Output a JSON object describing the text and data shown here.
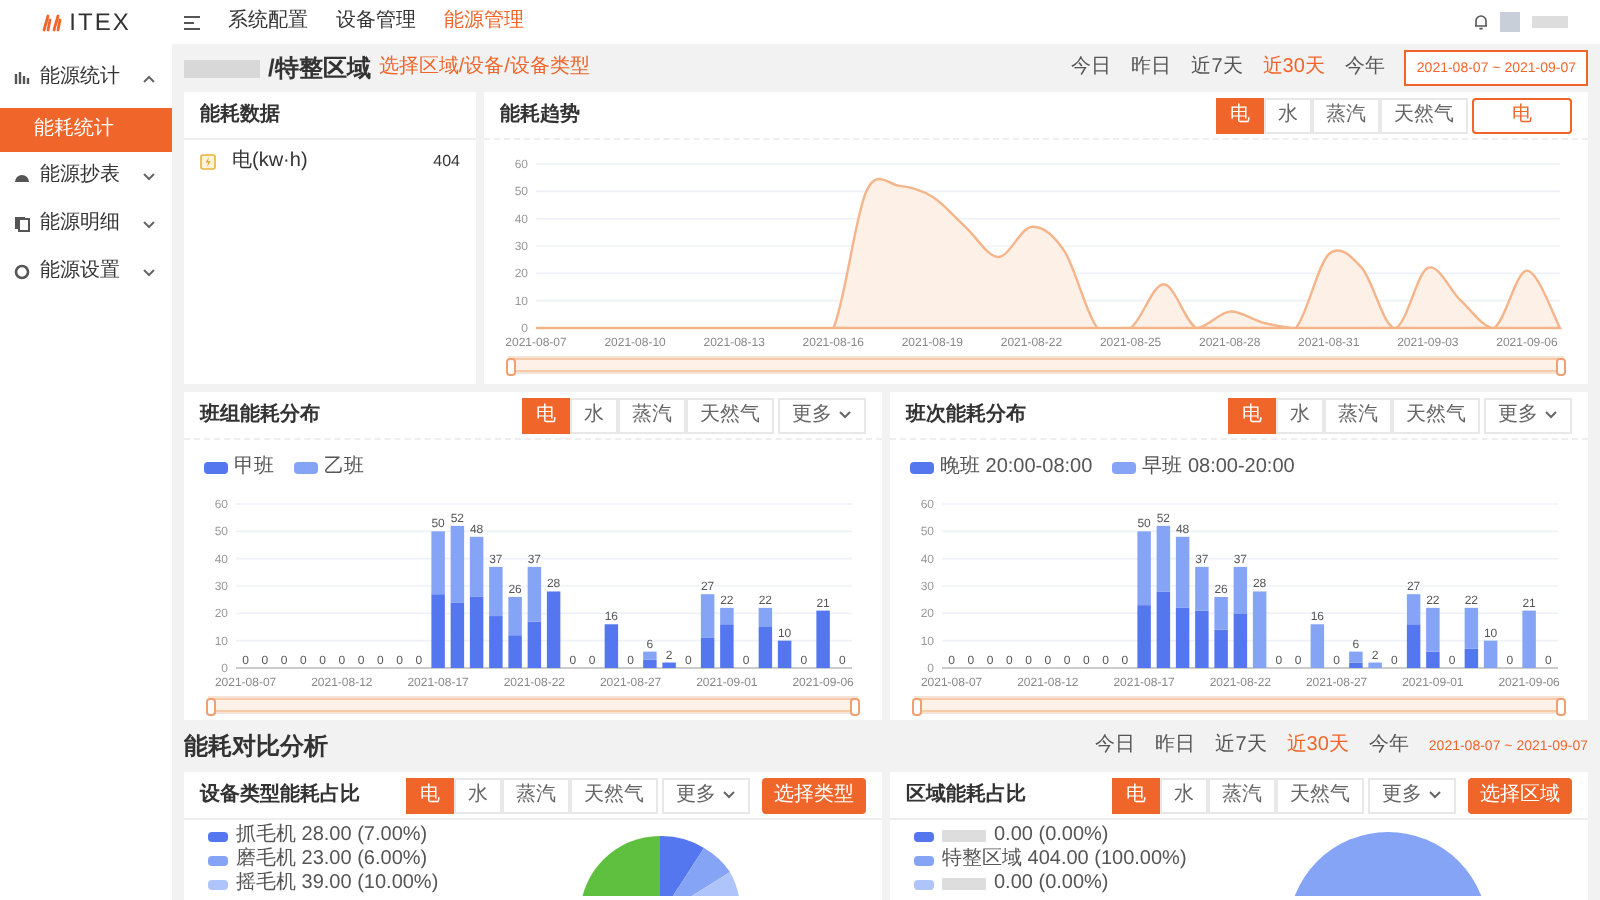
{
  "header": {
    "logo": "ITEX",
    "nav": [
      {
        "label": "系统配置",
        "selected": false
      },
      {
        "label": "设备管理",
        "selected": false
      },
      {
        "label": "能源管理",
        "selected": true
      }
    ]
  },
  "sidebar": {
    "items": [
      {
        "label": "能源统计",
        "expanded": true,
        "children": [
          {
            "label": "能耗统计",
            "selected": true
          }
        ]
      },
      {
        "label": "能源抄表",
        "expanded": false
      },
      {
        "label": "能源明细",
        "expanded": false
      },
      {
        "label": "能源设置",
        "expanded": false
      }
    ]
  },
  "breadcrumb": {
    "current": "/特整区域",
    "link": "选择区域/设备/设备类型"
  },
  "date_filter": {
    "options": [
      {
        "label": "今日",
        "selected": false
      },
      {
        "label": "昨日",
        "selected": false
      },
      {
        "label": "近7天",
        "selected": false
      },
      {
        "label": "近30天",
        "selected": true
      },
      {
        "label": "今年",
        "selected": false
      }
    ],
    "range": "2021-08-07 ~ 2021-09-07"
  },
  "energy_data": {
    "title": "能耗数据",
    "rows": [
      {
        "label": "电(kw·h)",
        "value": "404"
      }
    ]
  },
  "trend": {
    "title": "能耗趋势",
    "tabs": [
      {
        "label": "电",
        "selected": true
      },
      {
        "label": "水",
        "selected": false
      },
      {
        "label": "蒸汽",
        "selected": false
      },
      {
        "label": "天然气",
        "selected": false
      }
    ],
    "unit_button": "电",
    "chart_data": {
      "type": "area",
      "grid": true,
      "categories": [
        "2021-08-07",
        null,
        null,
        "2021-08-10",
        null,
        null,
        "2021-08-13",
        null,
        null,
        "2021-08-16",
        null,
        null,
        "2021-08-19",
        null,
        null,
        "2021-08-22",
        null,
        null,
        "2021-08-25",
        null,
        null,
        "2021-08-28",
        null,
        null,
        "2021-08-31",
        null,
        null,
        "2021-09-03",
        null,
        null,
        "2021-09-06",
        null
      ],
      "series": [
        {
          "color": "#f5b48a",
          "values": [
            0,
            0,
            0,
            0,
            0,
            0,
            0,
            0,
            0,
            0,
            50,
            52,
            48,
            37,
            26,
            37,
            28,
            0,
            0,
            16,
            0,
            6,
            2,
            0,
            27,
            22,
            0,
            22,
            10,
            0,
            21,
            0
          ]
        }
      ],
      "ylim": [
        0,
        60
      ],
      "yticks": [
        0,
        10,
        20,
        30,
        40,
        50,
        60
      ]
    },
    "zoom_slider": {
      "level": 1
    }
  },
  "team_distribution": {
    "title": "班组能耗分布",
    "tabs": [
      {
        "label": "电",
        "selected": true
      },
      {
        "label": "水",
        "selected": false
      },
      {
        "label": "蒸汽",
        "selected": false
      },
      {
        "label": "天然气",
        "selected": false
      }
    ],
    "more": "更多",
    "chart_data": {
      "type": "bar",
      "stacked": true,
      "grid": true,
      "categories": [
        "2021-08-07",
        null,
        null,
        null,
        null,
        "2021-08-12",
        null,
        null,
        null,
        null,
        "2021-08-17",
        null,
        null,
        null,
        null,
        "2021-08-22",
        null,
        null,
        null,
        null,
        "2021-08-27",
        null,
        null,
        null,
        null,
        "2021-09-01",
        null,
        null,
        null,
        null,
        "2021-09-06",
        null
      ],
      "series": [
        {
          "name": "甲班",
          "color": "#5477f0",
          "values": [
            0,
            0,
            0,
            0,
            0,
            0,
            0,
            0,
            0,
            0,
            27,
            24,
            26,
            19,
            12,
            17,
            28,
            0,
            0,
            16,
            0,
            3,
            2,
            0,
            11,
            16,
            0,
            15,
            10,
            0,
            21,
            0
          ]
        },
        {
          "name": "乙班",
          "color": "#86a4f6",
          "values": [
            0,
            0,
            0,
            0,
            0,
            0,
            0,
            0,
            0,
            0,
            23,
            28,
            22,
            18,
            14,
            20,
            0,
            0,
            0,
            0,
            0,
            3,
            0,
            0,
            16,
            6,
            0,
            7,
            0,
            0,
            0,
            0
          ]
        }
      ],
      "ylim": [
        0,
        60
      ],
      "yticks": [
        0,
        10,
        20,
        30,
        40,
        50,
        60
      ],
      "annotations": [
        {
          "y": 0,
          "text": "0"
        },
        {
          "y": 0,
          "text": "0"
        },
        {
          "y": 0,
          "text": "0"
        },
        {
          "y": 0,
          "text": "0"
        },
        {
          "y": 0,
          "text": "0"
        },
        {
          "y": 0,
          "text": "0"
        },
        {
          "y": 0,
          "text": "0"
        },
        {
          "y": 0,
          "text": "0"
        },
        {
          "y": 0,
          "text": "0"
        },
        {
          "y": 0,
          "text": "0"
        },
        {
          "y": 50,
          "text": "50"
        },
        {
          "y": 52,
          "text": "52"
        },
        {
          "y": 48,
          "text": "48"
        },
        {
          "y": 37,
          "text": "37"
        },
        {
          "y": 26,
          "text": "26"
        },
        {
          "y": 37,
          "text": "37"
        },
        {
          "y": 28,
          "text": "28"
        },
        {
          "y": 0,
          "text": "0"
        },
        {
          "y": 0,
          "text": "0"
        },
        {
          "y": 16,
          "text": "16"
        },
        {
          "y": 0,
          "text": "0"
        },
        {
          "y": 6,
          "text": "6"
        },
        {
          "y": 2,
          "text": "2"
        },
        {
          "y": 0,
          "text": "0"
        },
        {
          "y": 27,
          "text": "27"
        },
        {
          "y": 22,
          "text": "22"
        },
        {
          "y": 0,
          "text": "0"
        },
        {
          "y": 22,
          "text": "22"
        },
        {
          "y": 10,
          "text": "10"
        },
        {
          "y": 0,
          "text": "0"
        },
        {
          "y": 21,
          "text": "21"
        },
        {
          "y": 0,
          "text": "0"
        }
      ]
    },
    "zoom_slider": {
      "level": 1
    }
  },
  "shift_distribution": {
    "title": "班次能耗分布",
    "tabs": [
      {
        "label": "电",
        "selected": true
      },
      {
        "label": "水",
        "selected": false
      },
      {
        "label": "蒸汽",
        "selected": false
      },
      {
        "label": "天然气",
        "selected": false
      }
    ],
    "more": "更多",
    "chart_data": {
      "type": "bar",
      "stacked": true,
      "grid": true,
      "categories": [
        "2021-08-07",
        null,
        null,
        null,
        null,
        "2021-08-12",
        null,
        null,
        null,
        null,
        "2021-08-17",
        null,
        null,
        null,
        null,
        "2021-08-22",
        null,
        null,
        null,
        null,
        "2021-08-27",
        null,
        null,
        null,
        null,
        "2021-09-01",
        null,
        null,
        null,
        null,
        "2021-09-06",
        null
      ],
      "series": [
        {
          "name": "晚班 20:00-08:00",
          "color": "#5477f0",
          "values": [
            0,
            0,
            0,
            0,
            0,
            0,
            0,
            0,
            0,
            0,
            23,
            28,
            22,
            21,
            14,
            20,
            0,
            0,
            0,
            0,
            0,
            2,
            0,
            0,
            16,
            6,
            0,
            7,
            0,
            0,
            0,
            0
          ]
        },
        {
          "name": "早班 08:00-20:00",
          "color": "#86a4f6",
          "values": [
            0,
            0,
            0,
            0,
            0,
            0,
            0,
            0,
            0,
            0,
            27,
            24,
            26,
            16,
            12,
            17,
            28,
            0,
            0,
            16,
            0,
            4,
            2,
            0,
            11,
            16,
            0,
            15,
            10,
            0,
            21,
            0
          ]
        }
      ],
      "ylim": [
        0,
        60
      ],
      "yticks": [
        0,
        10,
        20,
        30,
        40,
        50,
        60
      ],
      "annotations": [
        {
          "y": 0,
          "text": "0"
        },
        {
          "y": 0,
          "text": "0"
        },
        {
          "y": 0,
          "text": "0"
        },
        {
          "y": 0,
          "text": "0"
        },
        {
          "y": 0,
          "text": "0"
        },
        {
          "y": 0,
          "text": "0"
        },
        {
          "y": 0,
          "text": "0"
        },
        {
          "y": 0,
          "text": "0"
        },
        {
          "y": 0,
          "text": "0"
        },
        {
          "y": 0,
          "text": "0"
        },
        {
          "y": 50,
          "text": "50"
        },
        {
          "y": 52,
          "text": "52"
        },
        {
          "y": 48,
          "text": "48"
        },
        {
          "y": 37,
          "text": "37"
        },
        {
          "y": 26,
          "text": "26"
        },
        {
          "y": 37,
          "text": "37"
        },
        {
          "y": 28,
          "text": "28"
        },
        {
          "y": 0,
          "text": "0"
        },
        {
          "y": 0,
          "text": "0"
        },
        {
          "y": 16,
          "text": "16"
        },
        {
          "y": 0,
          "text": "0"
        },
        {
          "y": 6,
          "text": "6"
        },
        {
          "y": 2,
          "text": "2"
        },
        {
          "y": 0,
          "text": "0"
        },
        {
          "y": 27,
          "text": "27"
        },
        {
          "y": 22,
          "text": "22"
        },
        {
          "y": 0,
          "text": "0"
        },
        {
          "y": 22,
          "text": "22"
        },
        {
          "y": 10,
          "text": "10"
        },
        {
          "y": 0,
          "text": "0"
        },
        {
          "y": 21,
          "text": "21"
        },
        {
          "y": 0,
          "text": "0"
        }
      ]
    },
    "zoom_slider": {
      "level": 1
    }
  },
  "comparison": {
    "title": "能耗对比分析",
    "date_filter": {
      "options": [
        {
          "label": "今日",
          "selected": false
        },
        {
          "label": "昨日",
          "selected": false
        },
        {
          "label": "近7天",
          "selected": false
        },
        {
          "label": "近30天",
          "selected": true
        },
        {
          "label": "今年",
          "selected": false
        }
      ],
      "range": "2021-08-07 ~ 2021-09-07"
    },
    "panels": [
      {
        "title": "设备类型能耗占比",
        "tabs": [
          {
            "label": "电",
            "selected": true
          },
          {
            "label": "水",
            "selected": false
          },
          {
            "label": "蒸汽",
            "selected": false
          },
          {
            "label": "天然气",
            "selected": false
          }
        ],
        "more": "更多",
        "button": "选择类型",
        "legend": [
          {
            "label": "抓毛机 28.00 (7.00%)",
            "color": "#5477f0",
            "name_hidden": false
          },
          {
            "label": "磨毛机 23.00 (6.00%)",
            "color": "#86a4f6",
            "name_hidden": false
          },
          {
            "label": "摇毛机 39.00 (10.00%)",
            "color": "#aec4fa",
            "name_hidden": false
          }
        ]
      },
      {
        "title": "区域能耗占比",
        "tabs": [
          {
            "label": "电",
            "selected": true
          },
          {
            "label": "水",
            "selected": false
          },
          {
            "label": "蒸汽",
            "selected": false
          },
          {
            "label": "天然气",
            "selected": false
          }
        ],
        "more": "更多",
        "button": "选择区域",
        "legend": [
          {
            "label": "0.00 (0.00%)",
            "color": "#5477f0",
            "name_hidden": true
          },
          {
            "label": "特整区域 404.00 (100.00%)",
            "color": "#86a4f6",
            "name_hidden": false
          },
          {
            "label": "0.00 (0.00%)",
            "color": "#aec4fa",
            "name_hidden": true
          }
        ]
      }
    ]
  }
}
